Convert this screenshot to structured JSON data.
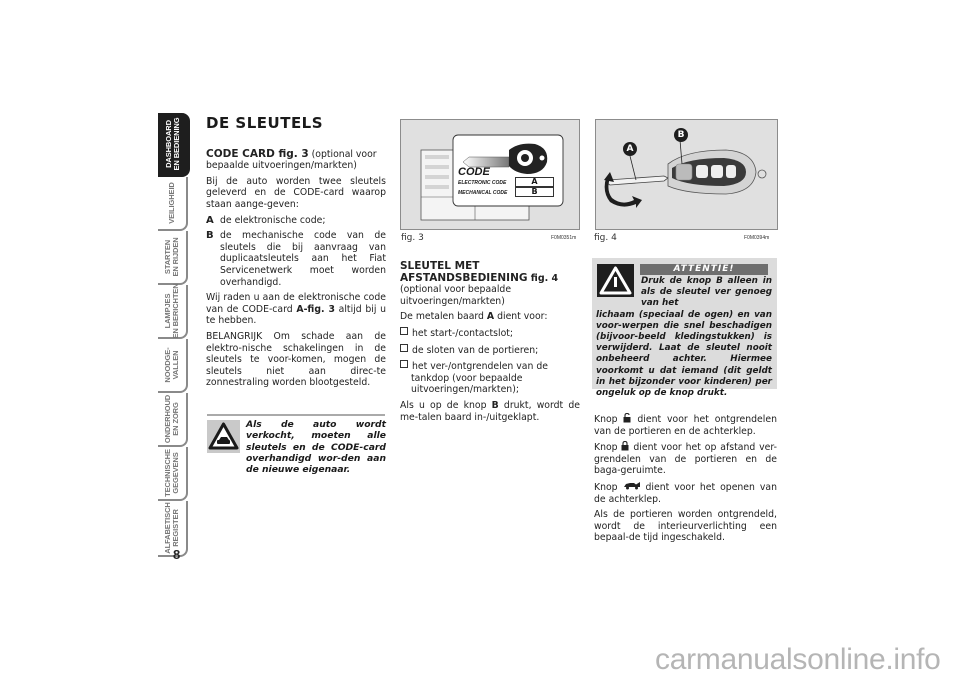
{
  "sidebar": {
    "tabs": [
      {
        "label": "DASHBOARD\nEN BEDIENING",
        "active": true
      },
      {
        "label": "VEILIGHEID",
        "active": false
      },
      {
        "label": "STARTEN\nEN RIJDEN",
        "active": false
      },
      {
        "label": "LAMPJES\nEN BERICHTEN",
        "active": false
      },
      {
        "label": "NOODGE-\nVALLEN",
        "active": false
      },
      {
        "label": "ONDERHOUD\nEN ZORG",
        "active": false
      },
      {
        "label": "TECHNISCHE\nGEGEVENS",
        "active": false
      },
      {
        "label": "ALFABETISCH\nREGISTER",
        "active": false
      }
    ],
    "page_number": "8"
  },
  "left_column": {
    "title": "DE SLEUTELS",
    "section_heading": "CODE CARD fig. 3",
    "section_heading_note": " (optional voor bepaalde uitvoeringen/markten)",
    "intro": "Bij de auto worden twee sleutels geleverd en de CODE-card waarop staan aange-geven:",
    "items": [
      {
        "key": "A",
        "text": "de elektronische code;"
      },
      {
        "key": "B",
        "text": "de mechanische code van de sleutels die bij aanvraag van duplicaatsleutels aan het Fiat Servicenetwerk moet worden overhandigd."
      }
    ],
    "advice_pre": "Wij raden u aan de elektronische code van de CODE-card ",
    "advice_ref": "A-fig. 3",
    "advice_post": " altijd bij u te hebben.",
    "important": "BELANGRIJK Om schade aan de elektro-nische schakelingen in de sleutels te voor-komen, mogen de sleutels niet aan direc-te zonnestraling worden blootgesteld.",
    "note": "Als de auto wordt verkocht, moeten alle sleutels en de CODE-card overhandigd wor-den aan de nieuwe eigenaar.",
    "note_icon": "car-warning-triangle-icon"
  },
  "fig3": {
    "caption": "fig. 3",
    "code": "F0M0351m",
    "card_title": "CODE",
    "row1_label": "ELECTRONIC CODE",
    "row1_value": "A",
    "row2_label": "MECHANICAL CODE",
    "row2_value": "B"
  },
  "middle_column": {
    "heading_line1": "SLEUTEL MET",
    "heading_line2": "AFSTANDSBEDIENING",
    "heading_ref": " fig. 4",
    "heading_note": "(optional voor bepaalde uitvoeringen/markten)",
    "intro_pre": "De metalen baard ",
    "intro_key": "A",
    "intro_post": " dient voor:",
    "bullets": [
      "het start-/contactslot;",
      "de sloten van de portieren;",
      "het ver-/ontgrendelen van de tankdop (voor bepaalde uitvoeringen/markten);"
    ],
    "outro_pre": "Als u op de knop ",
    "outro_key": "B",
    "outro_post": " drukt, wordt de me-talen baard in-/uitgeklapt."
  },
  "fig4": {
    "caption": "fig. 4",
    "code": "F0M0394m",
    "label_a": "A",
    "label_b": "B"
  },
  "attention": {
    "title": "ATTENTIE!",
    "text_indented": "Druk de knop B alleen in als de sleutel ver genoeg van het",
    "text_rest": "lichaam (speciaal de ogen) en van voor-werpen die snel beschadigen (bijvoor-beeld kledingstukken) is verwijderd. Laat de sleutel nooit onbeheerd achter. Hiermee voorkomt u dat iemand (dit geldt in het bijzonder voor kinderen) per ongeluk op de knop drukt.",
    "icon": "warning-triangle-icon"
  },
  "right_column": {
    "p1_pre": "Knop ",
    "p1_post": " dient voor het ontgrendelen van de portieren en de achterklep.",
    "p1_icon": "unlock-icon",
    "p2_pre": "Knop ",
    "p2_post": " dient voor het op afstand ver-grendelen van de portieren en de baga-geruimte.",
    "p2_icon": "lock-icon",
    "p3_pre": "Knop ",
    "p3_post": " dient voor het openen van de achterklep.",
    "p3_icon": "car-trunk-icon",
    "p4": "Als de portieren worden ontgrendeld, wordt de interieurverlichting een bepaal-de tijd ingeschakeld."
  },
  "watermark": "carmanualsonline.info"
}
